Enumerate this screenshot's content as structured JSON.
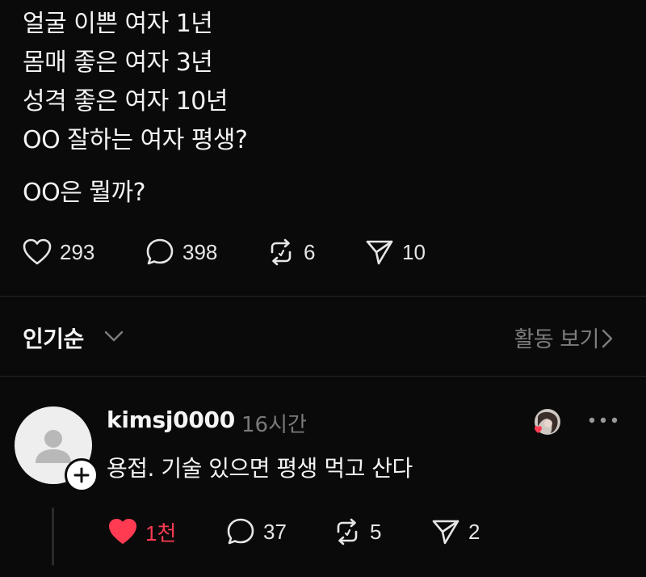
{
  "post": {
    "lines": [
      "얼굴 이쁜 여자 1년",
      "몸매 좋은 여자 3년",
      "성격 좋은 여자 10년",
      "OO 잘하는 여자 평생?"
    ],
    "question": "OO은 뭘까?",
    "actions": {
      "like_count": "293",
      "comment_count": "398",
      "repost_count": "6",
      "share_count": "10"
    }
  },
  "replies_header": {
    "sort_label": "인기순",
    "activity_label": "활동 보기"
  },
  "comment": {
    "username": "kimsj0000",
    "time": "16시간",
    "text": "용접. 기술 있으면 평생 먹고 산다",
    "actions": {
      "like_count": "1천",
      "comment_count": "37",
      "repost_count": "5",
      "share_count": "2"
    },
    "like_color": "#ff3b52"
  },
  "colors": {
    "background": "#0a0a0a",
    "text": "#f3f3f3",
    "muted": "#7a7a7a"
  }
}
